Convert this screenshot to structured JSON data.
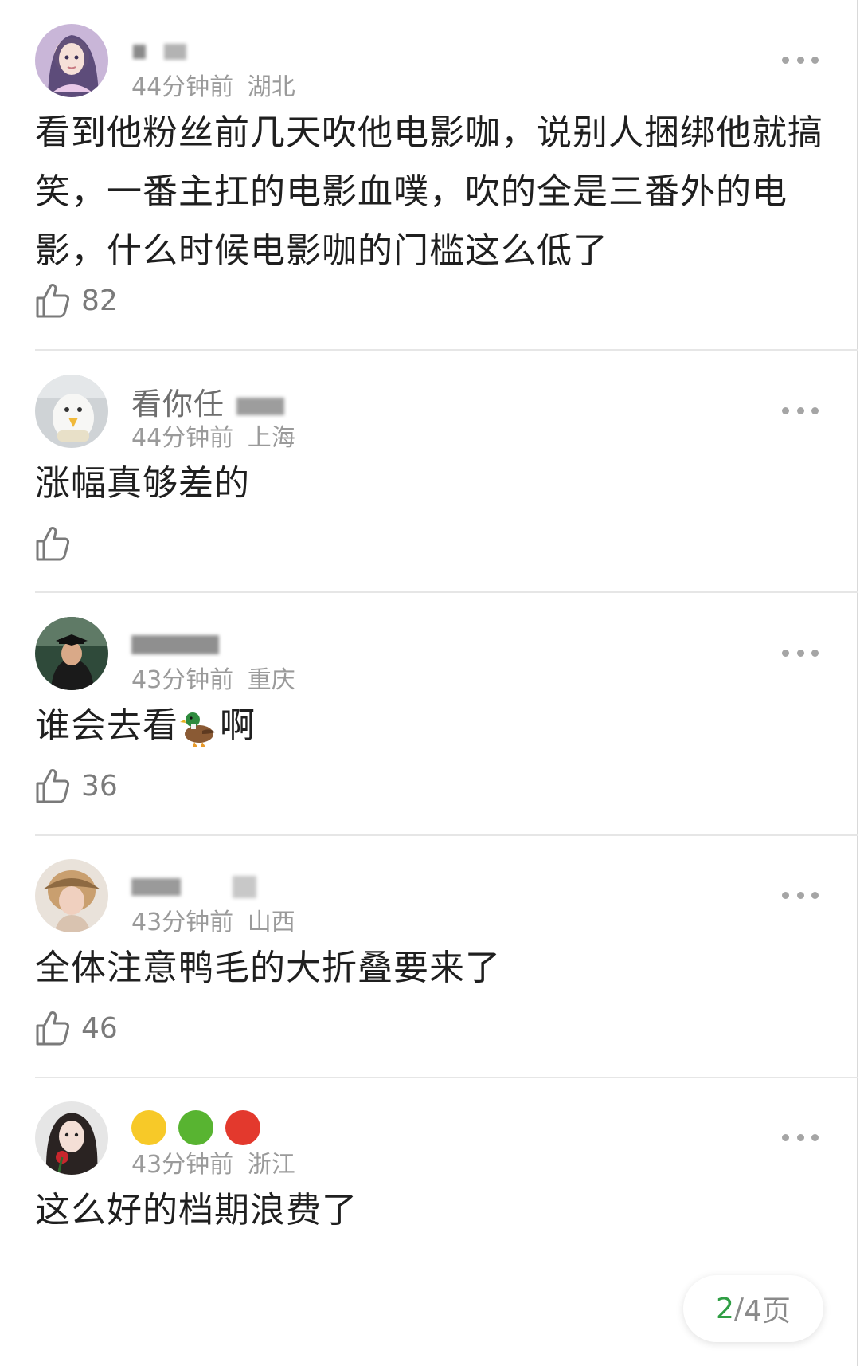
{
  "comments": [
    {
      "username": "",
      "time": "44分钟前",
      "location": "湖北",
      "text": "看到他粉丝前几天吹他电影咖，说别人捆绑他就搞笑，一番主扛的电影血噗，吹的全是三番外的电影，什么时候电影咖的门槛这么低了",
      "likes": "82"
    },
    {
      "username": "看你任",
      "time": "44分钟前",
      "location": "上海",
      "text": "涨幅真够差的",
      "likes": ""
    },
    {
      "username": "",
      "time": "43分钟前",
      "location": "重庆",
      "text_before": "谁会去看",
      "text_after": "啊",
      "emoji": "duck-emoji",
      "likes": "36"
    },
    {
      "username": "",
      "time": "43分钟前",
      "location": "山西",
      "text": "全体注意鸭毛的大折叠要来了",
      "likes": "46"
    },
    {
      "username": "",
      "time": "43分钟前",
      "location": "浙江",
      "text": "这么好的档期浪费了",
      "likes": ""
    }
  ],
  "pagination": {
    "current": "2",
    "separator": "/",
    "total_label": "4页"
  },
  "icons": {
    "like": "thumbs-up-icon",
    "more": "more-dots-icon"
  },
  "colors": {
    "page_current": "#2f9e44",
    "meta_text": "#9a9a9a",
    "divider": "#e6e6e6"
  }
}
